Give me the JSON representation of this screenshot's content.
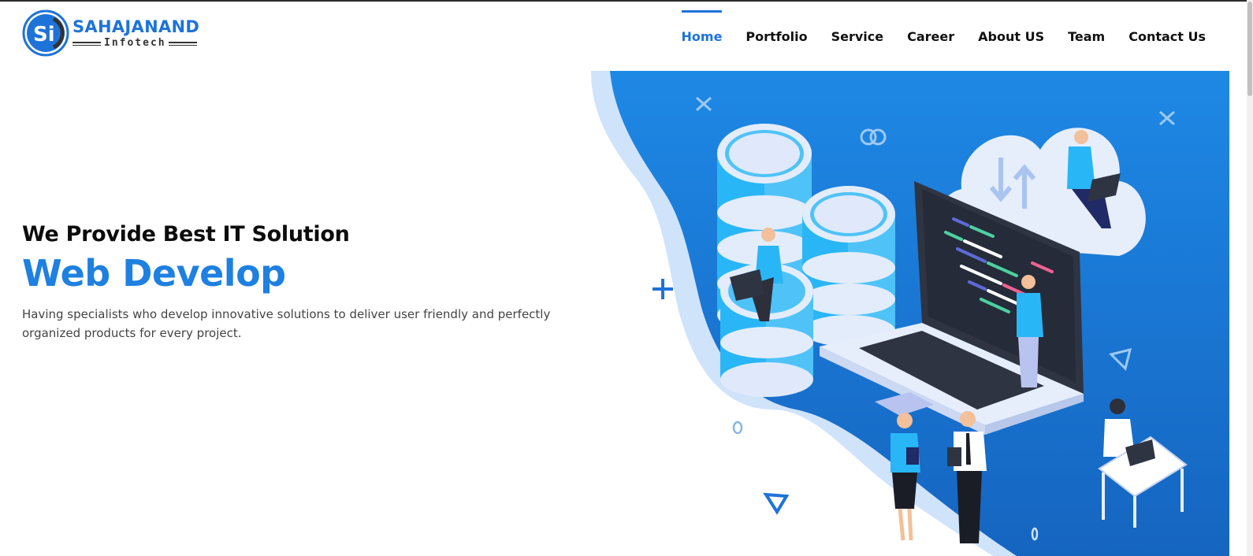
{
  "brand": {
    "name": "SAHAJANAND",
    "tagline": "Infotech",
    "badge_letters": "Si",
    "color": "#1e73d8"
  },
  "nav": {
    "items": [
      "Home",
      "Portfolio",
      "Service",
      "Career",
      "About US",
      "Team",
      "Contact Us"
    ],
    "active": "Home",
    "active_color": "#1e73d8"
  },
  "hero": {
    "kicker": "We Provide Best IT Solution",
    "headline": "Web Develop",
    "description": "Having specialists who develop innovative solutions to deliver user friendly and perfectly organized products for every project.",
    "headline_color": "#1e80e0"
  },
  "illustration": {
    "icons": [
      "database-stack-icon",
      "laptop-code-icon",
      "cloud-sync-icon",
      "people-icon",
      "desk-icon"
    ],
    "blob_color": "#1e80e0"
  }
}
